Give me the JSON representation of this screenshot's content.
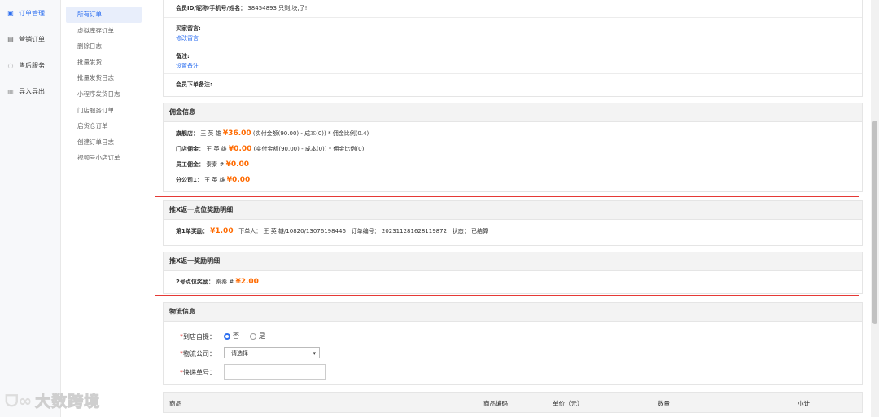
{
  "sidebar_main": {
    "items": [
      {
        "label": "订单管理",
        "icon": "order-icon",
        "active": true
      },
      {
        "label": "营销订单",
        "icon": "document-icon"
      },
      {
        "label": "售后服务",
        "icon": "refresh-icon"
      },
      {
        "label": "导入导出",
        "icon": "import-icon"
      }
    ]
  },
  "sidebar_sub": {
    "items": [
      "所有订单",
      "虚拟库存订单",
      "删除日志",
      "批量发货",
      "批量发货日志",
      "小程序发货日志",
      "门店服务订单",
      "启货仓订单",
      "创建订单日志",
      "视频号小店订单"
    ]
  },
  "member": {
    "id_label": "会员ID/昵称/手机号/姓名：",
    "id_value": "38454893  只剩,块,了!",
    "buyer_msg_label": "买家留言:",
    "buyer_msg_link": "修改留言",
    "remark_label": "备注:",
    "remark_link": "设置备注",
    "member_remark_label": "会员下单备注:"
  },
  "commission": {
    "title": "佣金信息",
    "flagship_label": "旗舰店：",
    "flagship_name": "王 英 雄",
    "flagship_amount": "¥36.00",
    "flagship_formula": "(实付金额(90.00) - 成本(0)) * 佣金比例(0.4)",
    "store_label": "门店佣金：",
    "store_name": "王 英 雄",
    "store_amount": "¥0.00",
    "store_formula": "(实付金额(90.00) - 成本(0)) * 佣金比例(0)",
    "staff_label": "员工佣金：",
    "staff_name": "秦秦 #",
    "staff_amount": "¥0.00",
    "branch_label": "分公司1：",
    "branch_name": "王 英 雄",
    "branch_amount": "¥0.00"
  },
  "reward1": {
    "title": "推X返一点位奖励明细",
    "label": "第1单奖励：",
    "amount": "¥1.00",
    "buyer_label": "下单人：",
    "buyer_value": "王 英 雄/10820/13076198446",
    "order_label": "订单编号：",
    "order_value": "202311281628119872",
    "status_label": "状态：",
    "status_value": "已结算"
  },
  "reward2": {
    "title": "推X返一奖励明细",
    "label": "2号点位奖励：",
    "name": "秦秦 #",
    "amount": "¥2.00"
  },
  "logistics": {
    "title": "物流信息",
    "pickup_label": "到店自提：",
    "opt_no": "否",
    "opt_yes": "是",
    "company_label": "物流公司：",
    "company_value": "请选择",
    "tracking_label": "快递单号："
  },
  "products_table": {
    "headers": [
      "商品",
      "商品编码",
      "单价（元）",
      "数量",
      "小计"
    ]
  },
  "watermark": {
    "text": "大数跨境"
  }
}
